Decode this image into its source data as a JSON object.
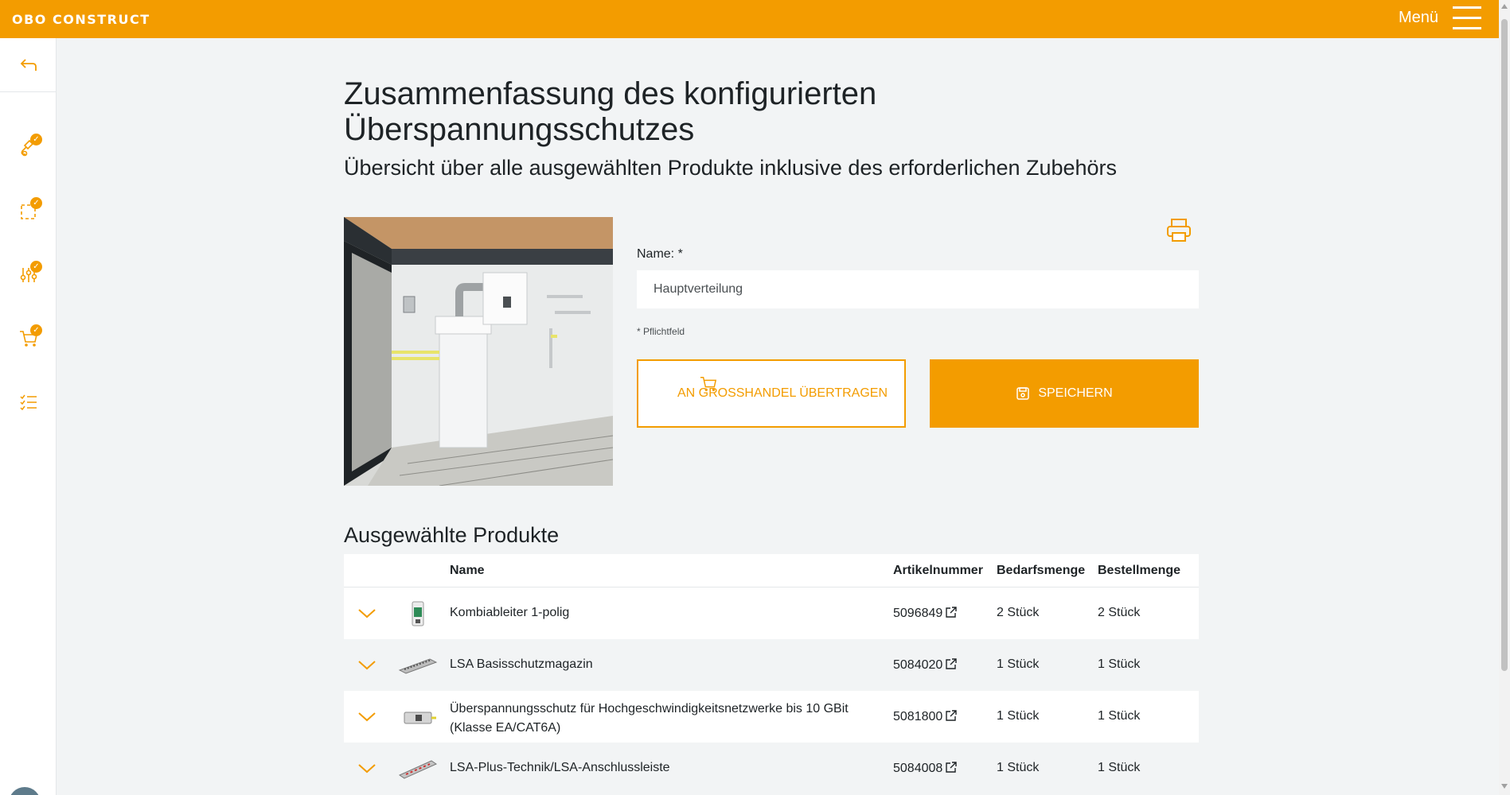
{
  "header": {
    "logo": "OBO CONSTRUCT",
    "menu_label": "Menü"
  },
  "page": {
    "title": "Zusammenfassung des konfigurierten Überspannungsschutzes",
    "subtitle": "Übersicht über alle ausgewählten Produkte inklusive des erforderlichen Zubehörs"
  },
  "form": {
    "name_label": "Name: *",
    "name_value": "Hauptverteilung",
    "required_note": "* Pflichtfeld",
    "transfer_button": "AN GROSSHANDEL ÜBERTRAGEN",
    "save_button": "SPEICHERN"
  },
  "products": {
    "section_title": "Ausgewählte Produkte",
    "columns": {
      "name": "Name",
      "article": "Artikelnummer",
      "demand": "Bedarfsmenge",
      "order": "Bestellmenge"
    },
    "rows": [
      {
        "name": "Kombiableiter 1-polig",
        "article": "5096849",
        "demand": "2 Stück",
        "order": "2 Stück"
      },
      {
        "name": "LSA Basisschutzmagazin",
        "article": "5084020",
        "demand": "1 Stück",
        "order": "1 Stück"
      },
      {
        "name": "Überspannungsschutz für Hochgeschwindigkeitsnetzwerke bis 10 GBit (Klasse EA/CAT6A)",
        "article": "5081800",
        "demand": "1 Stück",
        "order": "1 Stück"
      },
      {
        "name": "LSA-Plus-Technik/LSA-Anschlussleiste",
        "article": "5084008",
        "demand": "1 Stück",
        "order": "1 Stück"
      }
    ]
  },
  "sidebar": {
    "items": [
      {
        "icon": "back-arrow-icon"
      },
      {
        "icon": "plug-icon",
        "done": true
      },
      {
        "icon": "selection-icon",
        "done": true
      },
      {
        "icon": "sliders-icon",
        "done": true
      },
      {
        "icon": "cart-icon",
        "done": true
      },
      {
        "icon": "checklist-icon"
      }
    ]
  },
  "colors": {
    "accent": "#f39c00",
    "background": "#f2f4f5",
    "text": "#1e2326",
    "close_button": "#5e7b8b"
  }
}
